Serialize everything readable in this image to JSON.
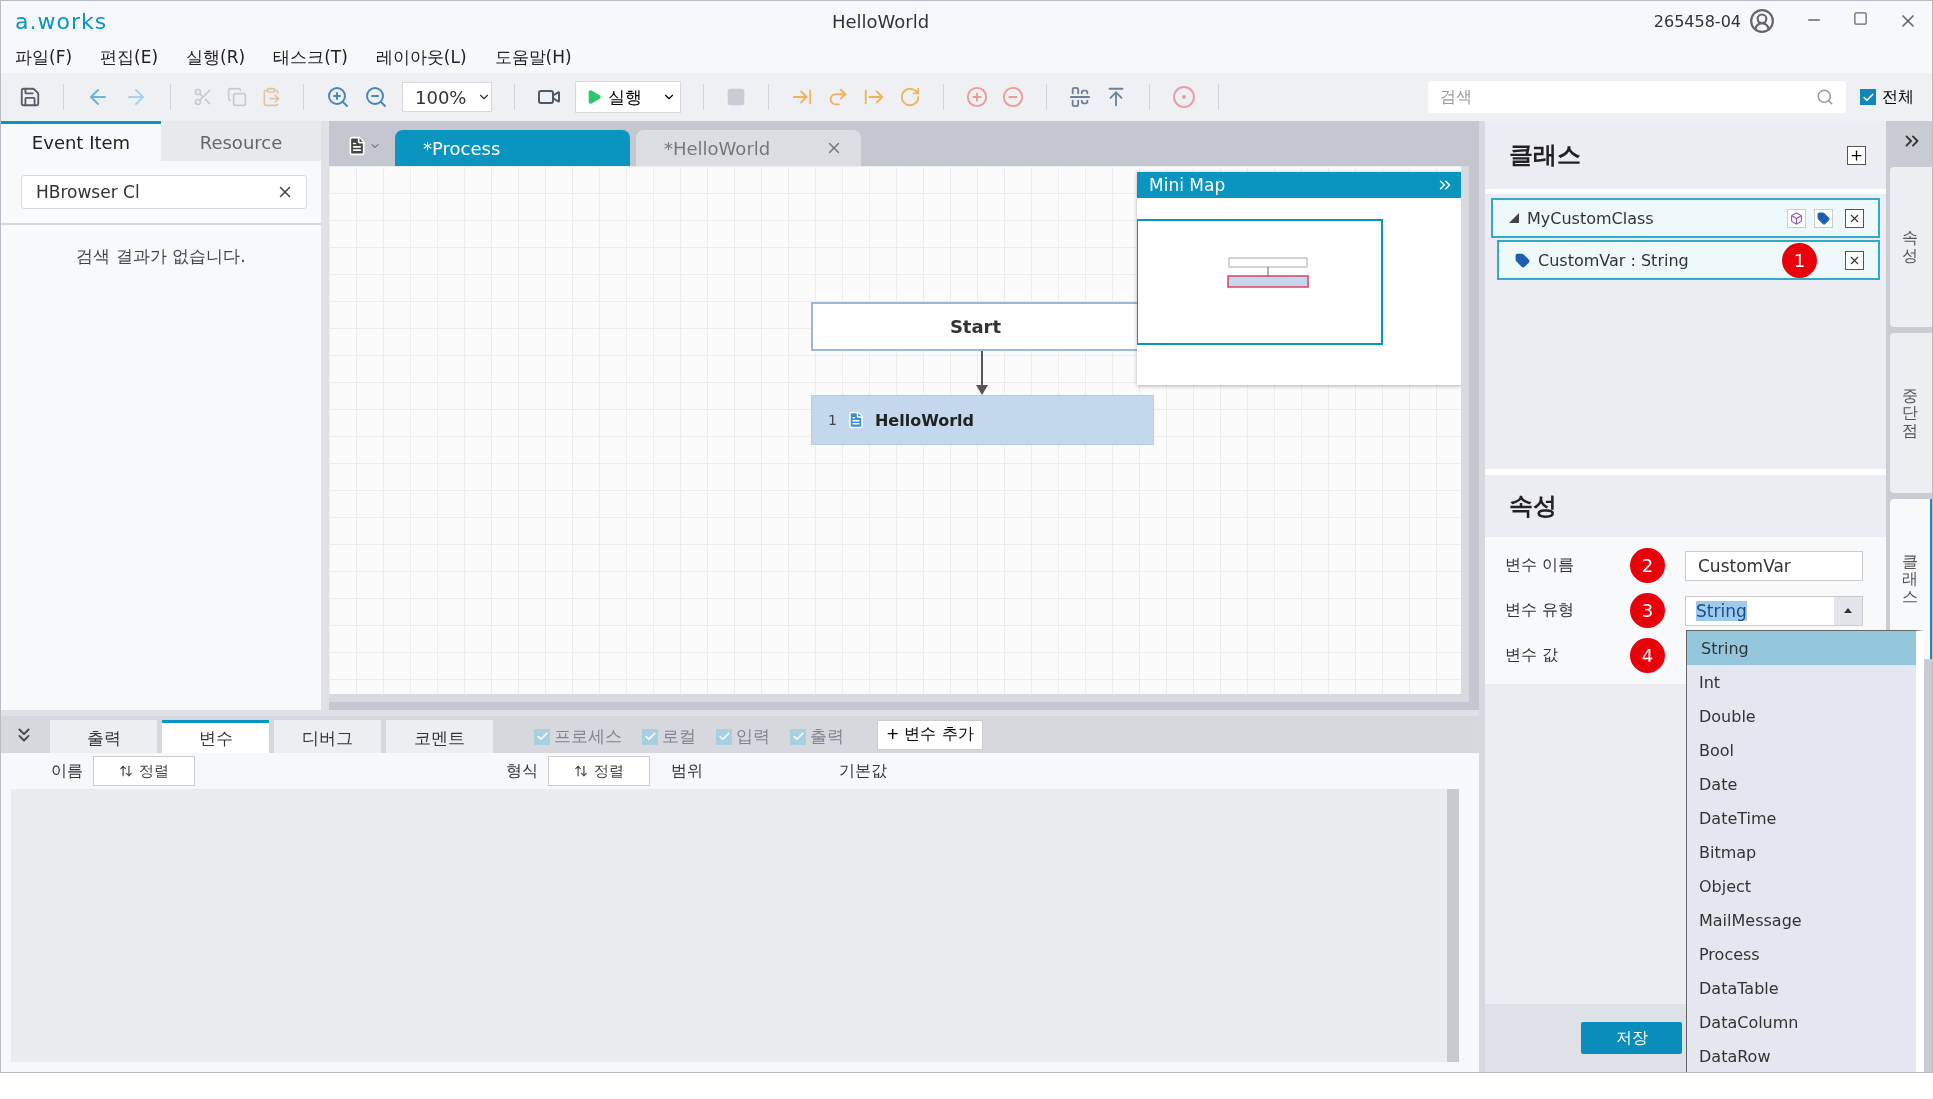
{
  "app": {
    "logo": "a.works",
    "title": "HelloWorld",
    "user": "265458-04"
  },
  "menu": [
    "파일(F)",
    "편집(E)",
    "실행(R)",
    "태스크(T)",
    "레이아웃(L)",
    "도움말(H)"
  ],
  "toolbar": {
    "zoom": "100%",
    "run": "실행",
    "search_placeholder": "검색",
    "all": {
      "label": "전체",
      "checked": true
    }
  },
  "left_panel": {
    "tabs": [
      {
        "label": "Event Item",
        "selected": true
      },
      {
        "label": "Resource",
        "selected": false
      }
    ],
    "search_value": "HBrowser Cl",
    "empty_message": "검색 결과가 없습니다."
  },
  "editor_tabs": [
    {
      "label": "*Process",
      "selected": true
    },
    {
      "label": "*HelloWorld",
      "selected": false
    }
  ],
  "canvas": {
    "start": "Start",
    "activity": {
      "number": "1",
      "label": "HelloWorld",
      "selected": true
    }
  },
  "minimap": {
    "title": "Mini Map"
  },
  "bottom_panel": {
    "tabs": [
      {
        "label": "출력",
        "selected": false
      },
      {
        "label": "변수",
        "selected": true
      },
      {
        "label": "디버그",
        "selected": false
      },
      {
        "label": "코멘트",
        "selected": false
      }
    ],
    "filters": [
      {
        "label": "프로세스",
        "checked": true,
        "disabled": true
      },
      {
        "label": "로컬",
        "checked": true,
        "disabled": true
      },
      {
        "label": "입력",
        "checked": true,
        "disabled": true
      },
      {
        "label": "출력",
        "checked": true,
        "disabled": true
      }
    ],
    "add_button": "+ 변수 추가",
    "columns": [
      {
        "label": "이름",
        "sort": "정렬"
      },
      {
        "label": "형식",
        "sort": "정렬"
      },
      {
        "label": "범위"
      },
      {
        "label": "기본값"
      }
    ]
  },
  "class_panel": {
    "title": "클래스",
    "tree": [
      {
        "label": "MyCustomClass",
        "expanded": true,
        "children": [
          {
            "label": "CustomVar : String",
            "badge": "1"
          }
        ]
      }
    ]
  },
  "properties": {
    "title": "속성",
    "fields": [
      {
        "label": "변수 이름",
        "badge": "2",
        "kind": "text",
        "value": "CustomVar"
      },
      {
        "label": "변수 유형",
        "badge": "3",
        "kind": "select",
        "value": "String"
      },
      {
        "label": "변수 값",
        "badge": "4",
        "kind": "covered"
      }
    ],
    "save": "저장"
  },
  "dropdown": [
    {
      "label": "String",
      "selected": true
    },
    {
      "label": "Int",
      "selected": false
    },
    {
      "label": "Double",
      "selected": false
    },
    {
      "label": "Bool",
      "selected": false
    },
    {
      "label": "Date",
      "selected": false
    },
    {
      "label": "DateTime",
      "selected": false
    },
    {
      "label": "Bitmap",
      "selected": false
    },
    {
      "label": "Object",
      "selected": false
    },
    {
      "label": "MailMessage",
      "selected": false
    },
    {
      "label": "Process",
      "selected": false
    },
    {
      "label": "DataTable",
      "selected": false
    },
    {
      "label": "DataColumn",
      "selected": false
    },
    {
      "label": "DataRow",
      "selected": false
    }
  ],
  "side_tabs": [
    {
      "label": "속성",
      "selected": false
    },
    {
      "label": "중단점",
      "selected": false
    },
    {
      "label": "클래스",
      "selected": true
    }
  ]
}
